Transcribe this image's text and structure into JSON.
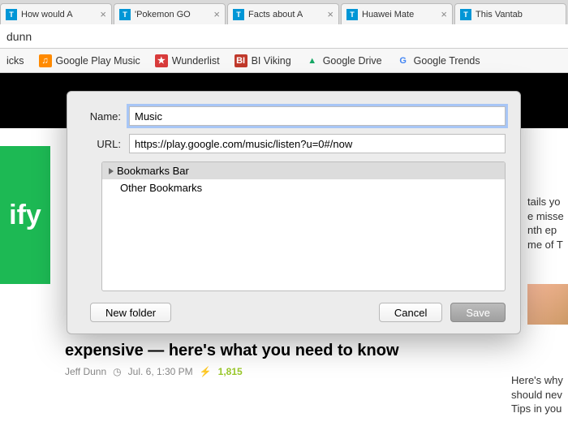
{
  "tabs": [
    {
      "title": "How would A"
    },
    {
      "title": "'Pokemon GO"
    },
    {
      "title": "Facts about A"
    },
    {
      "title": "Huawei Mate"
    },
    {
      "title": "This Vantab"
    }
  ],
  "url_fragment": "dunn",
  "bookmarks_bar": {
    "items": [
      {
        "label": "icks",
        "icon": "",
        "bg": "transparent",
        "fg": "#333"
      },
      {
        "label": "Google Play Music",
        "icon": "♫",
        "bg": "#ff8a00",
        "fg": "#fff"
      },
      {
        "label": "Wunderlist",
        "icon": "★",
        "bg": "#d83b3b",
        "fg": "#fff"
      },
      {
        "label": "BI Viking",
        "icon": "BI",
        "bg": "#c0392b",
        "fg": "#fff"
      },
      {
        "label": "Google Drive",
        "icon": "▲",
        "bg": "transparent",
        "fg": "#16a765"
      },
      {
        "label": "Google Trends",
        "icon": "G",
        "bg": "transparent",
        "fg": "#4285f4"
      }
    ]
  },
  "spotify_fragment": "ify",
  "article2": {
    "headline": "expensive — here's what you need to know",
    "author": "Jeff Dunn",
    "timestamp": "Jul. 6, 1:30 PM",
    "views": "1,815"
  },
  "right_frag": "tails yo e misse nth ep me of T",
  "right_frag2": "Here's why should nev Tips in you",
  "dialog": {
    "name_label": "Name:",
    "name_value": "Music",
    "url_label": "URL:",
    "url_value": "https://play.google.com/music/listen?u=0#/now",
    "folders": [
      {
        "label": "Bookmarks Bar",
        "selected": true,
        "expandable": true
      },
      {
        "label": "Other Bookmarks",
        "selected": false,
        "expandable": false
      }
    ],
    "new_folder": "New folder",
    "cancel": "Cancel",
    "save": "Save"
  }
}
